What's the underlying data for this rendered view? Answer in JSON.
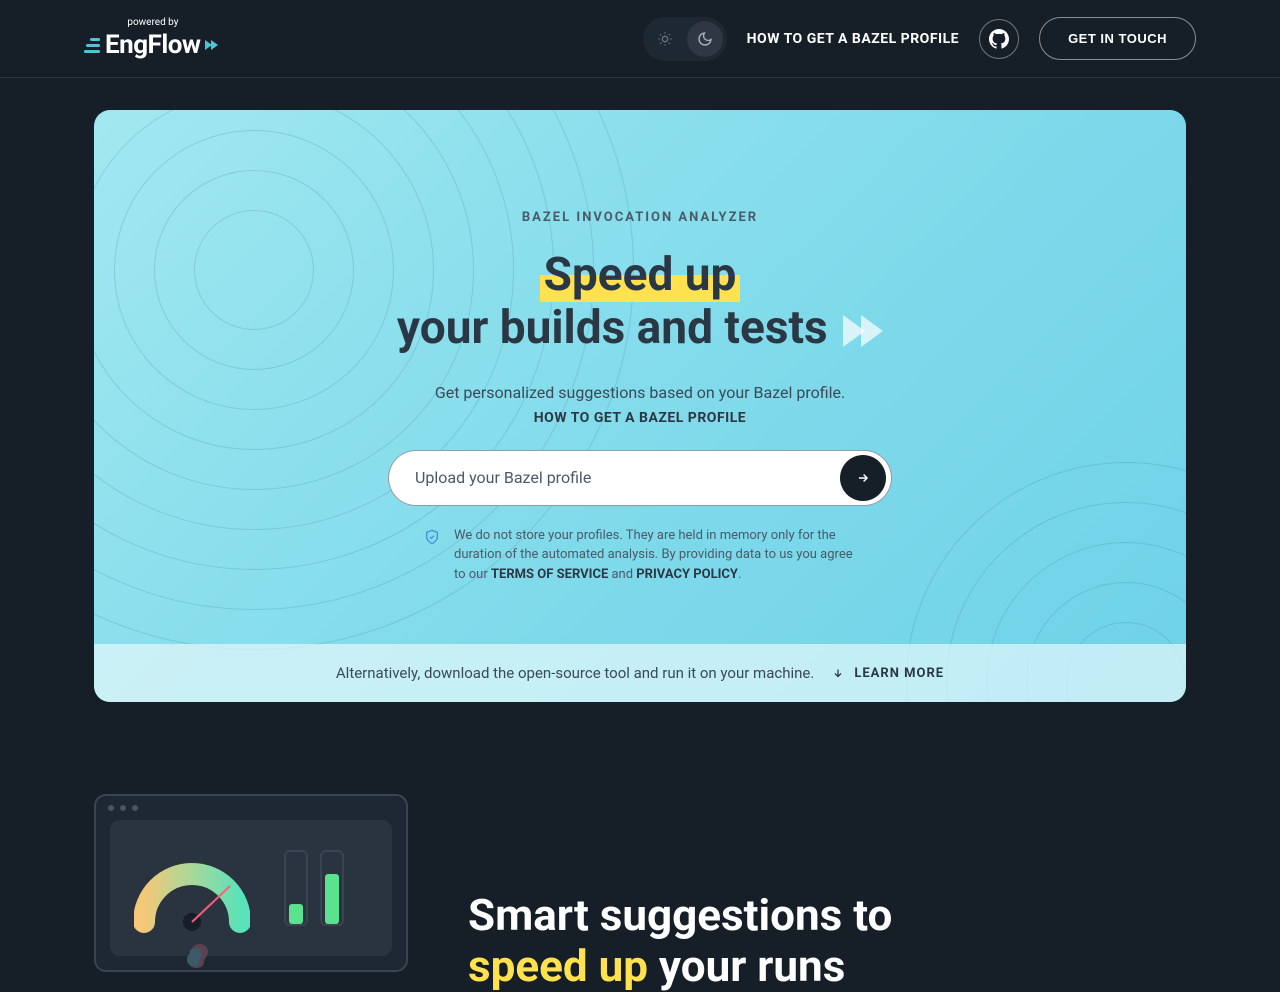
{
  "header": {
    "powered_by": "powered by",
    "logo_text": "EngFlow",
    "nav_bazel": "HOW TO GET A BAZEL PROFILE",
    "cta": "GET IN TOUCH"
  },
  "hero": {
    "eyebrow": "BAZEL INVOCATION ANALYZER",
    "title_highlight": "Speed up",
    "title_rest": "your builds and tests",
    "subtitle": "Get personalized suggestions based on your Bazel profile.",
    "sub_link": "HOW TO GET A BAZEL PROFILE",
    "upload_placeholder": "Upload your Bazel profile",
    "disclaimer_1": "We do not store your profiles. They are held in memory only for the duration of the automated analysis. By providing data to us you agree to our ",
    "tos": "TERMS OF SERVICE",
    "and": " and ",
    "pp": "PRIVACY POLICY",
    "period": ".",
    "footer_text": "Alternatively, download the open-source tool and run it on your machine.",
    "learn_more": "LEARN MORE"
  },
  "sec2": {
    "line1": "Smart suggestions to",
    "accent": "speed up",
    "line2_rest": " your runs"
  }
}
